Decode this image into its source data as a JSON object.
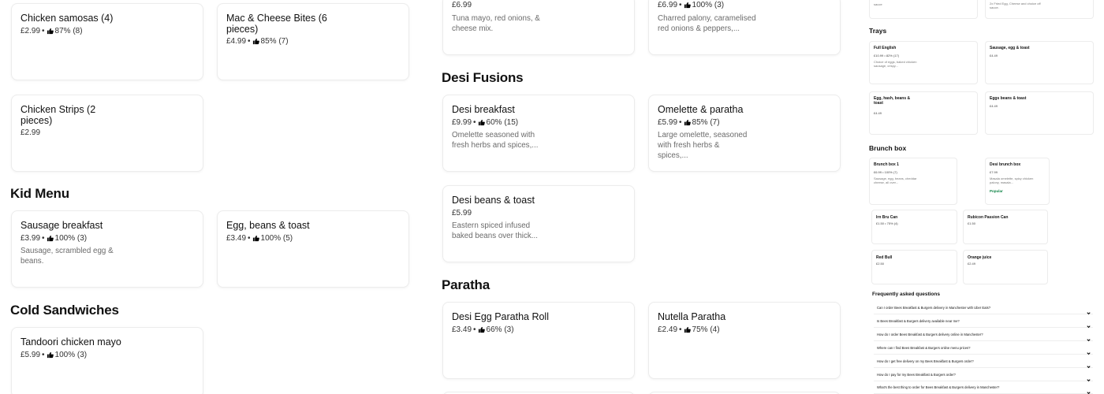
{
  "col1": [
    {
      "title": "Chicken samosas (4)",
      "price": "£2.99",
      "rating": "87% (8)"
    },
    {
      "title": "Chicken Strips (2\npieces)",
      "price": "£2.99"
    }
  ],
  "col2": [
    {
      "title": "Mac & Cheese Bites (6\npieces)",
      "price": "£4.99",
      "rating": "85% (7)"
    }
  ],
  "kid_menu": {
    "heading": "Kid Menu",
    "items": [
      {
        "title": "Sausage breakfast",
        "price": "£3.99",
        "rating": "100% (3)",
        "desc": "Sausage, scrambled egg & beans."
      },
      {
        "title": "Egg, beans & toast",
        "price": "£3.49",
        "rating": "100% (5)"
      }
    ]
  },
  "cold_sandwiches": {
    "heading": "Cold Sandwiches",
    "items": [
      {
        "title": "Tandoori chicken mayo",
        "price": "£5.99",
        "rating": "100% (3)"
      }
    ]
  },
  "top_row": [
    {
      "price": "£6.99",
      "desc": "Tuna mayo, red onions, & cheese mix."
    },
    {
      "price": "£6.99",
      "rating": "100% (3)",
      "desc": "Charred palony, caramelised red onions & peppers,..."
    }
  ],
  "desi_fusions": {
    "heading": "Desi Fusions",
    "items": [
      {
        "title": "Desi breakfast",
        "price": "£9.99",
        "rating": "60% (15)",
        "desc": "Omelette seasoned with fresh herbs and spices,..."
      },
      {
        "title": "Omelette & paratha",
        "price": "£5.99",
        "rating": "85% (7)",
        "desc": "Large omelette, seasoned with fresh herbs & spices,..."
      },
      {
        "title": "Desi beans & toast",
        "price": "£5.99",
        "desc": "Eastern spiced infused baked beans over thick..."
      }
    ]
  },
  "paratha": {
    "heading": "Paratha",
    "items": [
      {
        "title": "Desi Egg Paratha Roll",
        "price": "£3.49",
        "rating": "66% (3)"
      },
      {
        "title": "Nutella Paratha",
        "price": "£2.49",
        "rating": "75% (4)"
      }
    ]
  },
  "right": {
    "top_cards": [
      {
        "desc": "sauce"
      },
      {
        "desc": "2x Fried Egg, Cheese and choice off sauce."
      }
    ],
    "trays": {
      "heading": "Trays",
      "items": [
        {
          "title": "Full English",
          "meta": "£10.99 • 82% (17)",
          "desc": "Choice of eggs, baked chicken sausage, crispy..."
        },
        {
          "title": "Sausage, egg & toast",
          "meta": "£4.49"
        },
        {
          "title": "Egg, hash, beans & toast",
          "meta": "£4.49"
        },
        {
          "title": "Eggs beans & toast",
          "meta": "£4.49"
        }
      ]
    },
    "brunch": {
      "heading": "Brunch box",
      "items": [
        {
          "title": "Brunch box 1",
          "meta": "£6.99 • 100% (7)",
          "desc": "Sausage, egg, beans, cheddar cheese, all over..."
        },
        {
          "title": "Desi brunch box",
          "meta": "£7.99",
          "desc": "Masala omelette, spicy chicken palony, masala...",
          "badge": "Popular"
        }
      ]
    },
    "drinks": [
      {
        "title": "Irn Bru Can",
        "meta": "£1.50 • 75% (4)"
      },
      {
        "title": "Rubicon Passion Can",
        "meta": "£1.50"
      },
      {
        "title": "Red Bull",
        "meta": "£2.50"
      },
      {
        "title": "Orange juice",
        "meta": "£2.49"
      }
    ],
    "faq": {
      "heading": "Frequently asked questions",
      "items": [
        "Can I order Bees Breakfast & Burgers delivery in Manchester with Uber Eats?",
        "Is Bees Breakfast & Burgers delivery available near me?",
        "How do I order Bees Breakfast & Burgers delivery online in Manchester?",
        "Where can I find Bees Breakfast & Burgers online menu prices?",
        "How do I get free delivery on my Bees Breakfast & Burgers order?",
        "How do I pay for my Bees Breakfast & Burgers order?",
        "What's the best thing to order for Bees Breakfast & Burgers delivery in Manchester?"
      ]
    }
  }
}
